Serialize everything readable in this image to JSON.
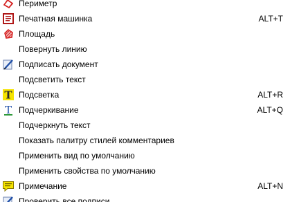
{
  "menu": {
    "items": [
      {
        "label": "Периметр",
        "shortcut": "",
        "icon": "perimeter-icon"
      },
      {
        "label": "Печатная машинка",
        "shortcut": "ALT+T",
        "icon": "typewriter-icon"
      },
      {
        "label": "Площадь",
        "shortcut": "",
        "icon": "area-icon"
      },
      {
        "label": "Повернуть линию",
        "shortcut": "",
        "icon": ""
      },
      {
        "label": "Подписать документ",
        "shortcut": "",
        "icon": "sign-document-icon"
      },
      {
        "label": "Подсветить текст",
        "shortcut": "",
        "icon": ""
      },
      {
        "label": "Подсветка",
        "shortcut": "ALT+R",
        "icon": "highlight-icon"
      },
      {
        "label": "Подчеркивание",
        "shortcut": "ALT+Q",
        "icon": "underline-icon"
      },
      {
        "label": "Подчеркнуть текст",
        "shortcut": "",
        "icon": ""
      },
      {
        "label": "Показать палитру стилей комментариев",
        "shortcut": "",
        "icon": ""
      },
      {
        "label": "Применить вид по умолчанию",
        "shortcut": "",
        "icon": ""
      },
      {
        "label": "Применить свойства по умолчанию",
        "shortcut": "",
        "icon": ""
      },
      {
        "label": "Примечание",
        "shortcut": "ALT+N",
        "icon": "note-icon"
      },
      {
        "label": "Проверить все подписи",
        "shortcut": "",
        "icon": "verify-signatures-icon"
      }
    ]
  },
  "colors": {
    "icon_red": "#d42020",
    "icon_blue": "#1f4fa8",
    "icon_yellow": "#f5e400",
    "icon_green": "#2f9a3a"
  }
}
